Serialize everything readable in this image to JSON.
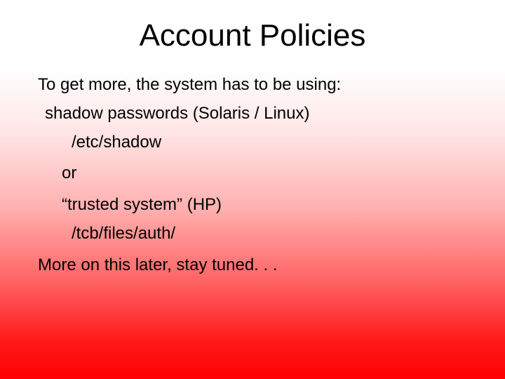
{
  "title": "Account Policies",
  "lines": {
    "l1": "To get more, the system has to be using:",
    "l2": "shadow passwords (Solaris / Linux)",
    "l3": "/etc/shadow",
    "l4": "or",
    "l5": "“trusted system” (HP)",
    "l6": "/tcb/files/auth/",
    "l7": "More on this later, stay tuned. . ."
  }
}
